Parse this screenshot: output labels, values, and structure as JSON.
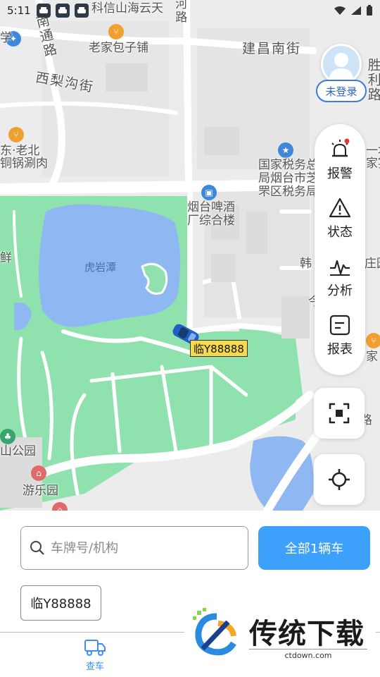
{
  "status_bar": {
    "time": "5:11",
    "app_icons": [
      "car-notification-icon",
      "car-notification-icon",
      "car-notification-icon"
    ],
    "right_icons": [
      "wifi-icon",
      "signal-icon",
      "battery-icon"
    ]
  },
  "map": {
    "labels": {
      "keixin": "科信山海云天",
      "he_road": "河路",
      "nan_tong_road": "南通路",
      "lao_jia_baozi": "老家包子铺",
      "jianchang_nan_jie": "建昌南街",
      "xi_li_gou_jie": "西梨沟街",
      "sheng_li_road": "胜利路",
      "dong_lao_bei_1": "东·老北",
      "dong_lao_bei_2": "铜锅涮肉",
      "tax_1": "国家税务总",
      "tax_2": "局烟台市芝",
      "tax_3": "罘区税务局",
      "brewery_1": "烟台啤酒",
      "brewery_2": "厂综合楼",
      "lake": "虎岩潭",
      "han_jie": "韩",
      "zhi_park_1": "山公园",
      "amusement_park": "游乐园",
      "ling_road": "路",
      "xian": "鲜",
      "jin": "今",
      "yi_kuai": "一块",
      "jia_yan": "家宴",
      "jia": "家",
      "zhuang_yuan": "庄园",
      "xue": "学"
    },
    "plate_label": "临Y88888"
  },
  "account": {
    "login_label": "未登录"
  },
  "side_panel": {
    "items": [
      {
        "label": "报警",
        "icon": "alarm-light-icon"
      },
      {
        "label": "状态",
        "icon": "warning-icon"
      },
      {
        "label": "分析",
        "icon": "pulse-icon"
      },
      {
        "label": "报表",
        "icon": "report-icon"
      }
    ],
    "fullscreen_icon": "fullscreen-icon",
    "locate_icon": "locate-icon"
  },
  "search": {
    "placeholder": "车牌号/机构",
    "value": ""
  },
  "all_vehicles_label": "全部1辆车",
  "vehicle_chip": "临Y88888",
  "tab_bar": {
    "items": [
      {
        "label": "查车",
        "icon": "truck-icon"
      }
    ]
  },
  "watermark": {
    "title": "传统下载",
    "url": "ctdown.com"
  },
  "colors": {
    "accent": "#3da0fb",
    "map_green": "#8fe2ad",
    "map_water": "#8fb8f2",
    "alarm_dot": "#e53935",
    "tab_active": "#3d8df5"
  }
}
